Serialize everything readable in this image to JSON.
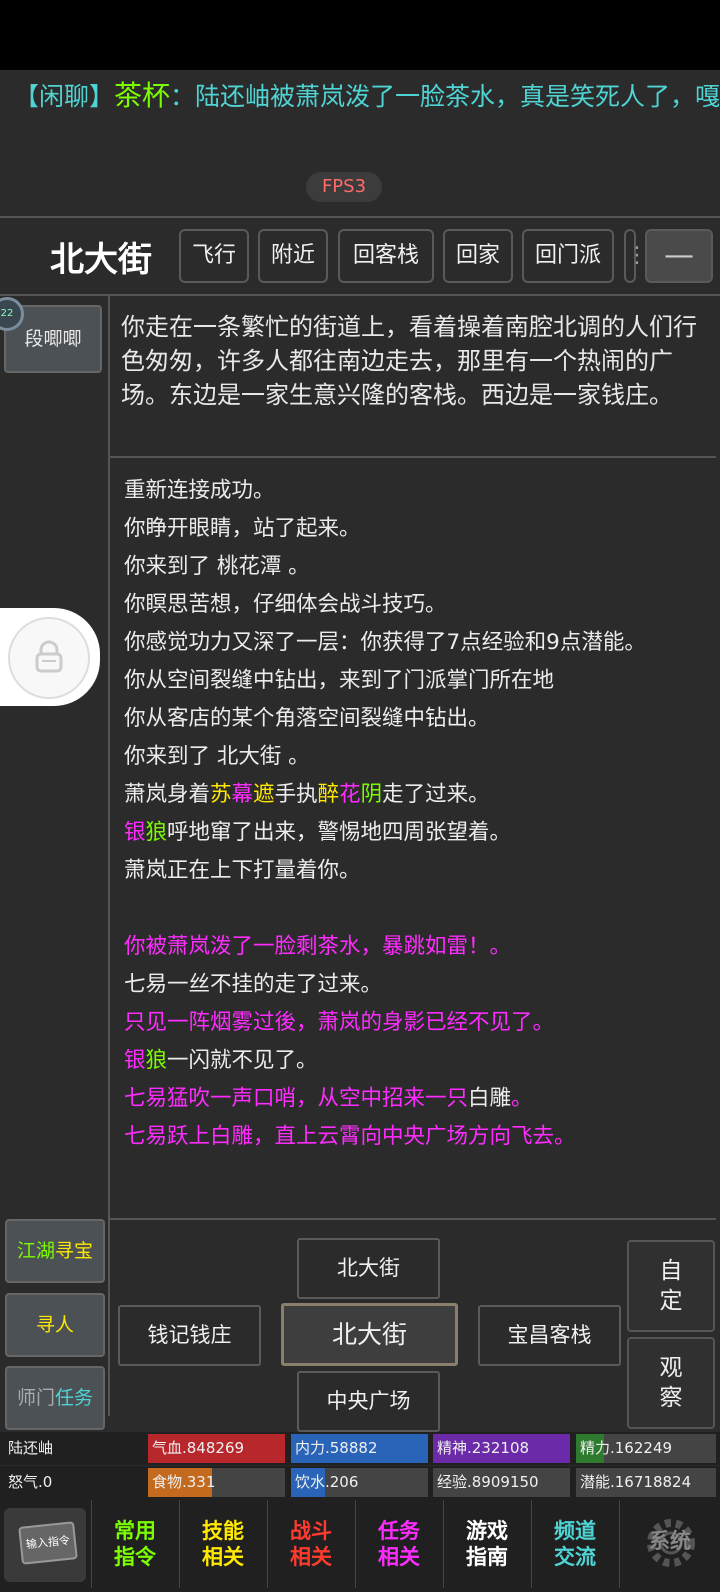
{
  "ticker": {
    "tag": "【闲聊】",
    "name": "茶杯",
    "message": "：陆还岫被萧岚泼了一脸茶水，真是笑死人了，嘎"
  },
  "fps": "FPS3",
  "location": "北大街",
  "top_buttons": [
    "飞行",
    "附近",
    "回客栈",
    "回家",
    "回门派"
  ],
  "menu_icon": "—",
  "npc": {
    "name": "段唧唧",
    "badge": "22"
  },
  "description": "你走在一条繁忙的街道上，看着操着南腔北调的人们行色匆匆，许多人都往南边走去，那里有一个热闹的广场。东边是一家生意兴隆的客栈。西边是一家钱庄。",
  "log": {
    "l1": "重新连接成功。",
    "l2": "你睁开眼睛，站了起来。",
    "l3": "你来到了 桃花潭 。",
    "l4": "你瞑思苦想，仔细体会战斗技巧。",
    "l5": "你感觉功力又深了一层：你获得了7点经验和9点潜能。",
    "l6": "你从空间裂缝中钻出，来到了门派掌门所在地",
    "l7": "你从客店的某个角落空间裂缝中钻出。",
    "l8": "你来到了 北大街 。",
    "l9a": "萧岚身着",
    "l9b": "苏",
    "l9c": "幕",
    "l9d": "遮",
    "l9e": "手执",
    "l9f": "醉",
    "l9g": "花",
    "l9h": "阴",
    "l9i": "走了过来。",
    "l10a": "银",
    "l10b": "狼",
    "l10c": "呼地窜了出来，警惕地四周张望着。",
    "l11": "萧岚正在上下打量着你。",
    "l12": "你被萧岚泼了一脸剩茶水，暴跳如雷！。",
    "l13": "七易一丝不挂的走了过来。",
    "l14": "只见一阵烟雾过後，萧岚的身影已经不见了。",
    "l15a": "银",
    "l15b": "狼",
    "l15c": "一闪就不见了。",
    "l16a": "七易猛吹一声口哨，从空中招来一只",
    "l16b": "白雕",
    "l16c": "。",
    "l17": "七易跃上白雕，直上云霄向中央广场方向飞去。"
  },
  "side_buttons": {
    "treasure_a": "江湖",
    "treasure_b": "寻宝",
    "find_person": "寻人",
    "master_a": "师门",
    "master_b": "任务"
  },
  "directions": {
    "north": "北大街",
    "west": "钱记钱庄",
    "center": "北大街",
    "east": "宝昌客栈",
    "south": "中央广场"
  },
  "right_buttons": {
    "custom": "自\n定",
    "observe": "观\n察"
  },
  "stats_row1": {
    "name": "陆还岫",
    "hp": "气血.848269",
    "force": "内力.58882",
    "spirit": "精神.232108",
    "energy": "精力.162249"
  },
  "stats_row2": {
    "rage": "怒气.0",
    "food": "食物.331",
    "water": "饮水.206",
    "exp": "经验.8909150",
    "potential": "潜能.16718824"
  },
  "bar_fill": {
    "food": 0.47,
    "water": 0.25,
    "energy": 0.2
  },
  "bottom": {
    "input": "输入指令",
    "b1a": "常用",
    "b1b": "指令",
    "b2a": "技能",
    "b2b": "相关",
    "b3a": "战斗",
    "b3b": "相关",
    "b4a": "任务",
    "b4b": "相关",
    "b5a": "游戏",
    "b5b": "指南",
    "b6a": "频道",
    "b6b": "交流",
    "b7": "系统"
  },
  "colors": {
    "magenta": "#ff2cff",
    "yellow": "#ffe900",
    "green": "#7cfc00",
    "cyan": "#4fd3d3",
    "hp": "#b8272b",
    "force": "#2a64b8",
    "spirit": "#6b2aa8"
  }
}
